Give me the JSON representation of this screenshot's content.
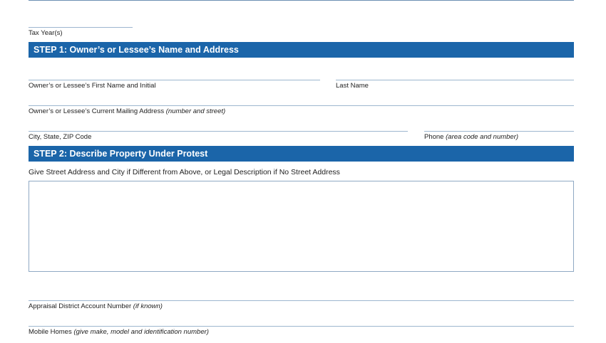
{
  "form": {
    "tax_years_label": "Tax Year(s)",
    "step1": {
      "title": "STEP 1: Owner’s or Lessee’s Name and Address",
      "first_name_label": "Owner’s or Lessee’s First Name and Initial",
      "last_name_label": "Last Name",
      "mailing_address_label": "Owner’s or Lessee’s Current Mailing Address",
      "mailing_address_hint": "(number and street)",
      "city_state_zip_label": "City, State, ZIP Code",
      "phone_label": "Phone",
      "phone_hint": "(area code and number)"
    },
    "step2": {
      "title": "STEP 2: Describe Property Under Protest",
      "instruction": "Give Street Address and City if Different from Above, or Legal Description if No Street Address",
      "account_number_label": "Appraisal District Account Number",
      "account_number_hint": "(if known)",
      "mobile_homes_label": "Mobile Homes",
      "mobile_homes_hint": "(give make, model and identification number)"
    }
  }
}
